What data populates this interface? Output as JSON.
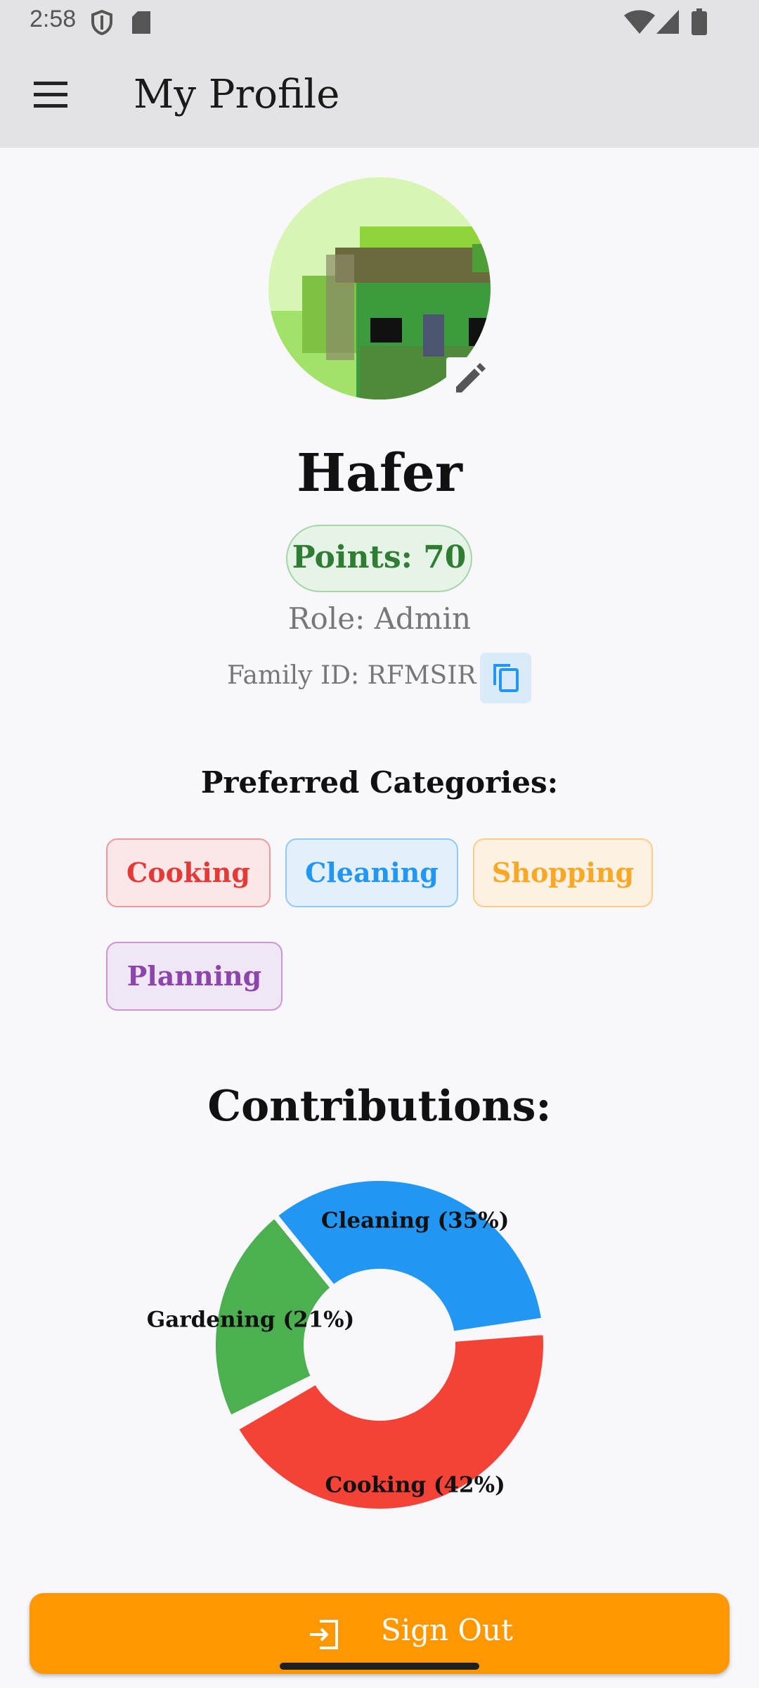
{
  "status_bar": {
    "time": "2:58"
  },
  "app_bar": {
    "title": "My Profile",
    "menu_icon": "menu-icon"
  },
  "profile": {
    "name": "Hafer",
    "points": "Points: 70",
    "role": "Role: Admin",
    "family_id": "Family ID: RFMSIR"
  },
  "preferred": {
    "title": "Preferred Categories:",
    "chips": [
      {
        "label": "Cooking",
        "color": "#e53935",
        "bg": "#fbe7e8",
        "border": "#ef9a9a"
      },
      {
        "label": "Cleaning",
        "color": "#2196f3",
        "bg": "#e3f0fc",
        "border": "#90caf9"
      },
      {
        "label": "Shopping",
        "color": "#f9a825",
        "bg": "#fdf1e4",
        "border": "#ffcc80"
      },
      {
        "label": "Planning",
        "color": "#8e44ad",
        "bg": "#efe6f6",
        "border": "#ce93d8"
      }
    ]
  },
  "contributions": {
    "title": "Contributions:"
  },
  "chart_data": {
    "type": "pie",
    "donut": true,
    "slices": [
      {
        "label": "Cleaning (35%)",
        "name": "Cleaning",
        "value": 35,
        "color": "#2196f3"
      },
      {
        "label": "Cooking (42%)",
        "name": "Cooking",
        "value": 42,
        "color": "#f44336"
      },
      {
        "label": "Gardening (21%)",
        "name": "Gardening",
        "value": 21,
        "color": "#4caf50"
      }
    ],
    "title": "",
    "legend": "none"
  },
  "signout": {
    "label": "Sign Out",
    "icon": "logout-icon"
  }
}
